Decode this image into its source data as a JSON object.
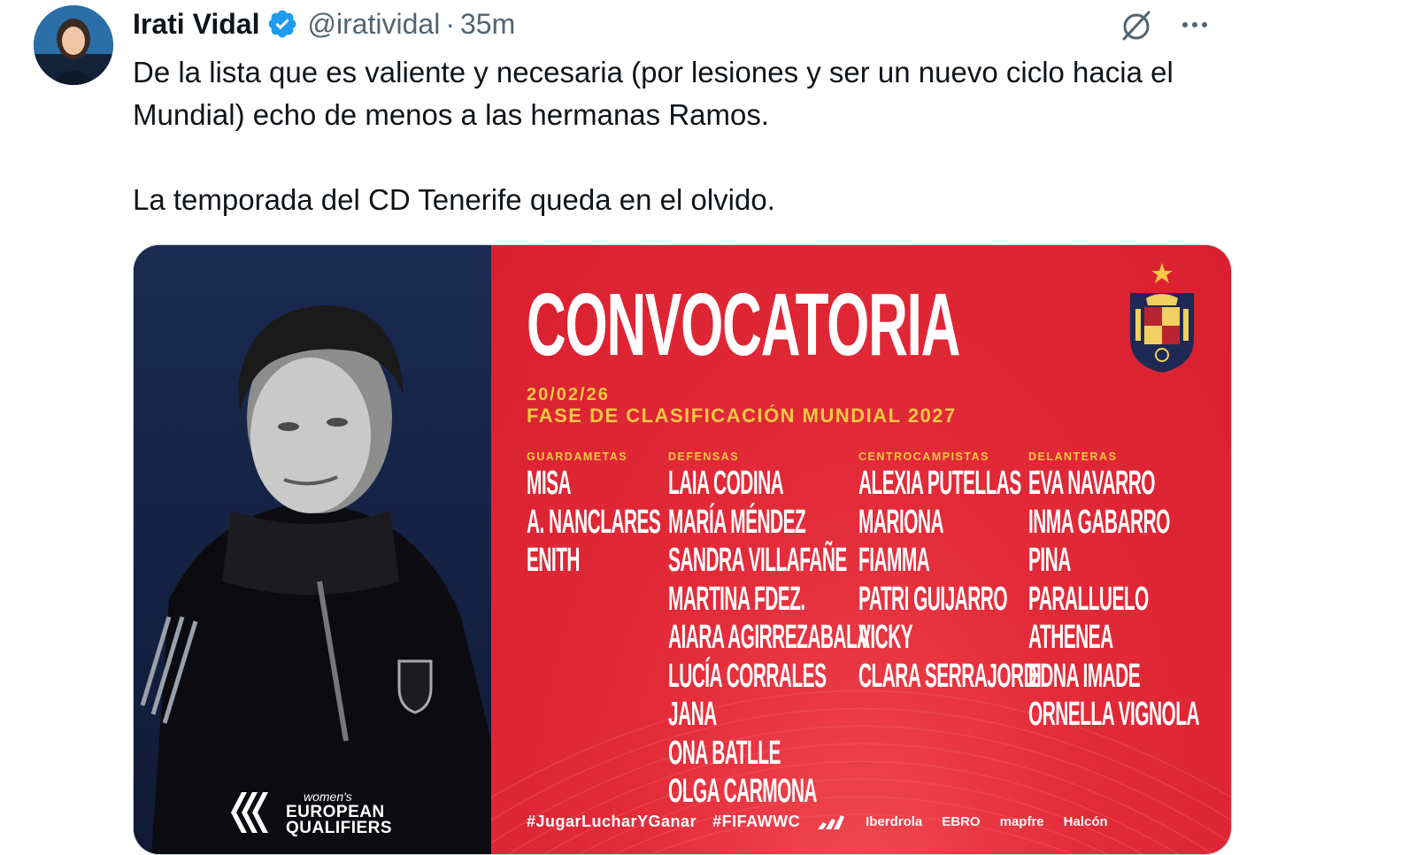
{
  "tweet": {
    "author_name": "Irati Vidal",
    "handle": "@iratividal",
    "separator": "·",
    "time": "35m",
    "text_lines": [
      "De la lista que es valiente y necesaria (por lesiones y ser un nuevo ciclo hacia el Mundial) echo de menos a las hermanas Ramos.",
      "La temporada del CD Tenerife queda en el olvido."
    ]
  },
  "icons": {
    "avatar": "avatar",
    "verified": "verified-badge-icon",
    "grok": "grok-icon",
    "more": "more-options-icon"
  },
  "media": {
    "title": "CONVOCATORIA",
    "date": "20/02/26",
    "phase": "FASE DE CLASIFICACIÓN MUNDIAL 2027",
    "columns": [
      {
        "header": "GUARDAMETAS",
        "players": [
          "MISA",
          "A. NANCLARES",
          "ENITH"
        ]
      },
      {
        "header": "DEFENSAS",
        "players": [
          "LAIA CODINA",
          "MARÍA MÉNDEZ",
          "SANDRA VILLAFAÑE",
          "MARTINA FDEZ.",
          "AIARA AGIRREZABALA",
          "LUCÍA CORRALES",
          "JANA",
          "ONA BATLLE",
          "OLGA CARMONA"
        ]
      },
      {
        "header": "CENTROCAMPISTAS",
        "players": [
          "ALEXIA PUTELLAS",
          "MARIONA",
          "FIAMMA",
          "PATRI GUIJARRO",
          "VICKY",
          "CLARA SERRAJORDI"
        ]
      },
      {
        "header": "DELANTERAS",
        "players": [
          "EVA NAVARRO",
          "INMA GABARRO",
          "PINA",
          "PARALLUELO",
          "ATHENEA",
          "EDNA IMADE",
          "ORNELLA VIGNOLA"
        ]
      }
    ],
    "hashtags": [
      "#JugarLucharYGanar",
      "#FIFAWWC"
    ],
    "sponsors": [
      "Iberdrola",
      "EBRO",
      "mapfre",
      "Halcón"
    ],
    "qualifiers_small": "women's",
    "qualifiers_line1": "EUROPEAN",
    "qualifiers_line2": "QUALIFIERS",
    "colors": {
      "red": "#e32a38",
      "navy": "#17264a",
      "gold": "#f7c844"
    }
  }
}
